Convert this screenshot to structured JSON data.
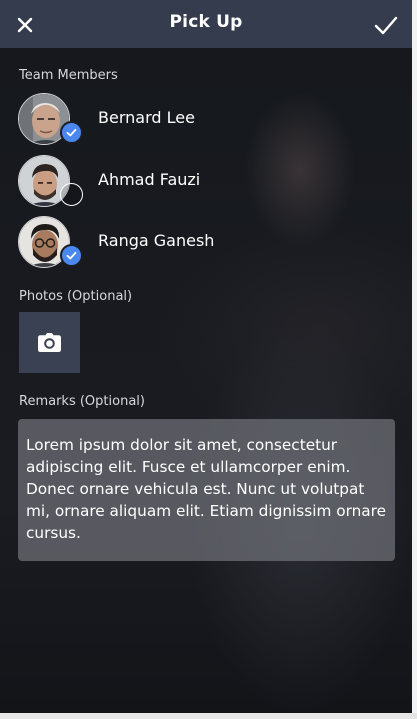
{
  "header": {
    "title": "Pick Up",
    "close_icon": "close-icon",
    "confirm_icon": "checkmark-icon"
  },
  "team_members": {
    "label": "Team Members",
    "members": [
      {
        "name": "Bernard Lee",
        "selected": true
      },
      {
        "name": "Ahmad Fauzi",
        "selected": false
      },
      {
        "name": "Ranga Ganesh",
        "selected": true
      }
    ]
  },
  "photos": {
    "label": "Photos (Optional)",
    "icon": "camera-icon"
  },
  "remarks": {
    "label": "Remarks (Optional)",
    "value": "Lorem ipsum dolor sit amet, consectetur adipiscing elit. Fusce et ullamcorper enim. Donec ornare vehicula est. Nunc ut volutpat mi, ornare aliquam elit. Etiam dignissim ornare cursus."
  },
  "colors": {
    "topbar": "#353c4d",
    "accent": "#4a88f0"
  }
}
